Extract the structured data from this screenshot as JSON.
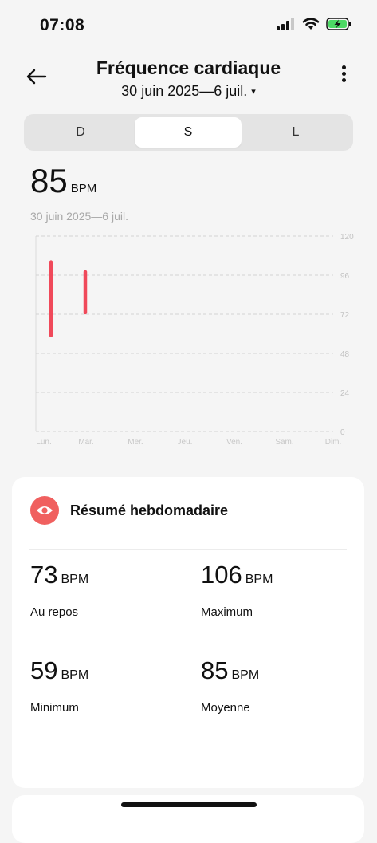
{
  "status": {
    "time": "07:08",
    "colors": {
      "battery": "#4cd964"
    }
  },
  "header": {
    "title": "Fréquence cardiaque",
    "date_range": "30 juin 2025—6 juil.",
    "caret": "▾"
  },
  "tabs": [
    {
      "label": "D",
      "active": false
    },
    {
      "label": "S",
      "active": true
    },
    {
      "label": "L",
      "active": false
    }
  ],
  "summary": {
    "value": "85",
    "unit": "BPM",
    "date_text": "30 juin 2025—6 juil."
  },
  "chart_data": {
    "type": "bar",
    "categories": [
      "Lun.",
      "Mar.",
      "Mer.",
      "Jeu.",
      "Ven.",
      "Sam.",
      "Dim."
    ],
    "series": [
      {
        "ranges": [
          [
            59,
            104
          ],
          [
            73,
            98
          ],
          null,
          null,
          null,
          null,
          null
        ]
      }
    ],
    "ylim": [
      0,
      120
    ],
    "yticks": [
      0,
      24,
      48,
      72,
      96,
      120
    ],
    "grid": true,
    "bar_color": "#f0495a"
  },
  "weekly_summary": {
    "title": "Résumé hebdomadaire",
    "icon": "eye-icon",
    "accent_color": "#f0605f",
    "stats": [
      {
        "value": "73",
        "unit": "BPM",
        "label": "Au repos"
      },
      {
        "value": "106",
        "unit": "BPM",
        "label": "Maximum"
      },
      {
        "value": "59",
        "unit": "BPM",
        "label": "Minimum"
      },
      {
        "value": "85",
        "unit": "BPM",
        "label": "Moyenne"
      }
    ]
  }
}
